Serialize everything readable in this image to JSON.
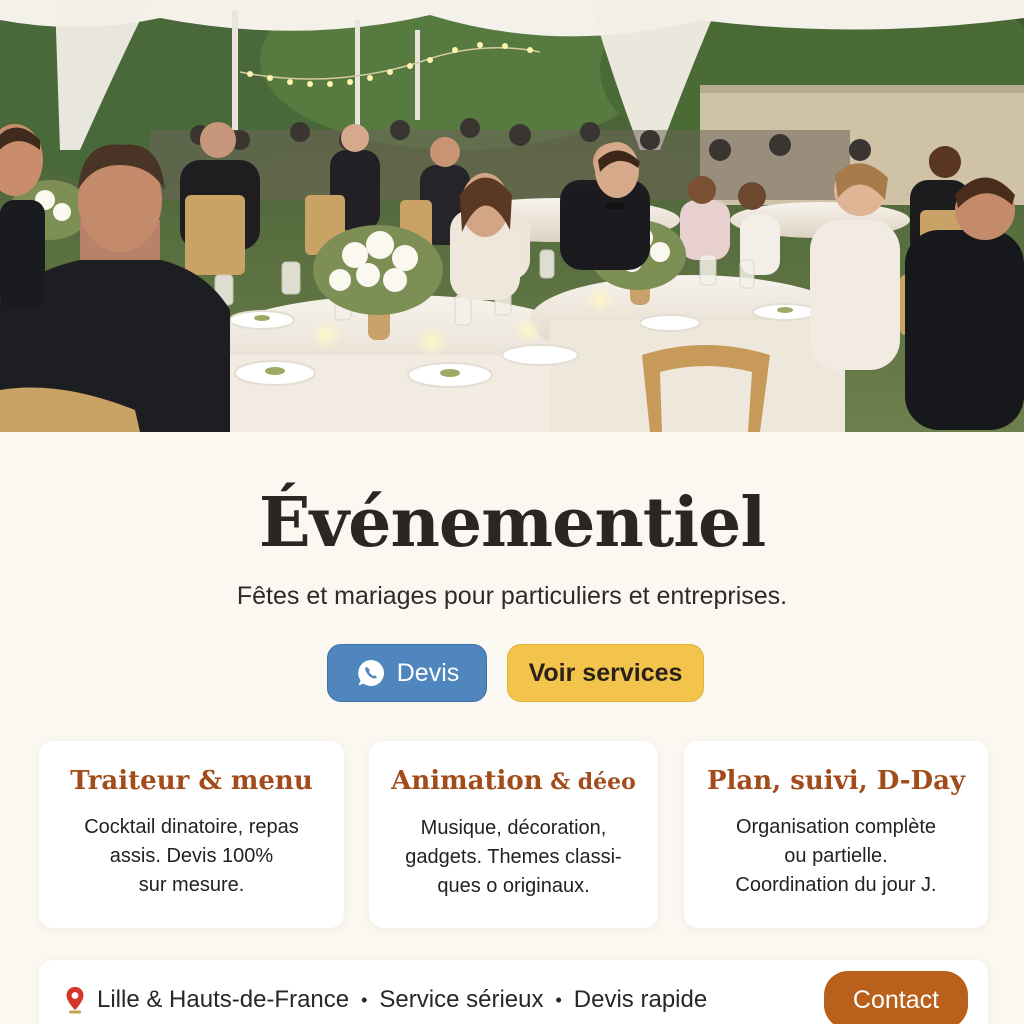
{
  "hero": {
    "image_icon": "wedding-reception-photo"
  },
  "header": {
    "title": "Événementiel",
    "subtitle": "Fêtes et mariages pour particuliers et entreprises."
  },
  "actions": {
    "devis_label": "Devis",
    "devis_icon": "chat-bubble-icon",
    "services_label": "Voir services"
  },
  "services": [
    {
      "title_main": "Traiteur & menu",
      "title_small": "",
      "lines": [
        "Cocktail dinatoire, repas",
        "assis. Devis 100%",
        "sur mesure."
      ]
    },
    {
      "title_main": "Animation",
      "title_small": " & déeo",
      "lines": [
        "Musique, décoration,",
        "gadgets. Themes classi-",
        "ques o originaux."
      ]
    },
    {
      "title_main": "Plan, suivi, D-Day",
      "title_small": "",
      "lines": [
        "Organisation complète",
        "ou partielle.",
        "Coordination du jour J."
      ]
    }
  ],
  "footer": {
    "location_icon": "map-pin-icon",
    "location": "Lille & Hauts-de-France",
    "separator": "•",
    "feature_1": "Service sérieux",
    "feature_2": "Devis rapide",
    "contact_label": "Contact"
  },
  "colors": {
    "background": "#fbf8f2",
    "title": "#2a2622",
    "card_title": "#a24c1c",
    "devis_button": "#4f86bd",
    "services_button": "#f2c44c",
    "contact_button": "#b9601d"
  }
}
